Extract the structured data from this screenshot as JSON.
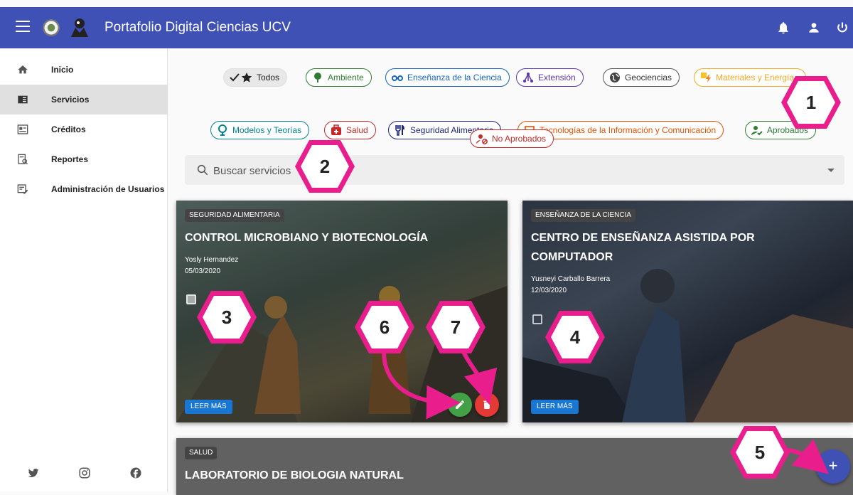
{
  "app": {
    "title": "Portafolio Digital Ciencias UCV"
  },
  "sidebar": {
    "items": [
      {
        "label": "Inicio",
        "icon": "home-icon"
      },
      {
        "label": "Servicios",
        "icon": "book-icon",
        "active": true
      },
      {
        "label": "Créditos",
        "icon": "id-card-icon"
      },
      {
        "label": "Reportes",
        "icon": "report-search-icon"
      },
      {
        "label": "Administración de Usuarios",
        "icon": "user-edit-icon"
      }
    ],
    "socials": [
      "twitter-icon",
      "instagram-icon",
      "facebook-icon"
    ]
  },
  "filters": {
    "chips": [
      {
        "label": "Todos",
        "color": "#444444",
        "icon": "check-star-icon"
      },
      {
        "label": "Ambiente",
        "color": "#2e7d32",
        "icon": "tree-icon"
      },
      {
        "label": "Enseñanza de la Ciencia",
        "color": "#1565c0",
        "icon": "glasses-icon"
      },
      {
        "label": "Extensión",
        "color": "#5e35b1",
        "icon": "network-icon"
      },
      {
        "label": "Geociencias",
        "color": "#555555",
        "icon": "globe-icon"
      },
      {
        "label": "Materiales y Energía",
        "color": "#f9a825",
        "icon": "bolt-icon"
      },
      {
        "label": "Modelos y Teorías",
        "color": "#00838f",
        "icon": "globe-stand-icon"
      },
      {
        "label": "Salud",
        "color": "#c62828",
        "icon": "medkit-icon"
      },
      {
        "label": "Seguridad Alimentaria",
        "color": "#1a237e",
        "icon": "utensils-icon"
      },
      {
        "label": "Tecnologías de la Información y Comunicación",
        "color": "#e65100",
        "icon": "laptop-icon"
      },
      {
        "label": "Aprobados",
        "color": "#2e7d32",
        "icon": "user-check-icon"
      },
      {
        "label": "No Aprobados",
        "color": "#c62828",
        "icon": "user-block-icon"
      }
    ]
  },
  "search": {
    "placeholder": "Buscar servicios"
  },
  "cards": [
    {
      "category": "SEGURIDAD ALIMENTARIA",
      "title": "CONTROL MICROBIANO Y BIOTECNOLOGÍA",
      "author": "Yosly Hernandez",
      "date": "05/03/2020",
      "checked": true,
      "read_more": "LEER MÁS"
    },
    {
      "category": "ENSEÑANZA DE LA CIENCIA",
      "title_line1": "CENTRO DE ENSEÑANZA ASISTIDA POR",
      "title_line2": "COMPUTADOR",
      "author": "Yusneyi Carballo Barrera",
      "date": "12/03/2020",
      "checked": false,
      "read_more": "LEER MÁS"
    },
    {
      "category": "SALUD",
      "title": "LABORATORIO DE BIOLOGIA NATURAL"
    }
  ],
  "actions": {
    "edit_color": "#43a047",
    "delete_color": "#e53935",
    "add_color": "#3f51b5",
    "add_label": "+"
  },
  "annotations": [
    "1",
    "2",
    "3",
    "4",
    "5",
    "6",
    "7"
  ],
  "colors": {
    "primary": "#3f51b5",
    "annotation": "#e91e8c"
  }
}
